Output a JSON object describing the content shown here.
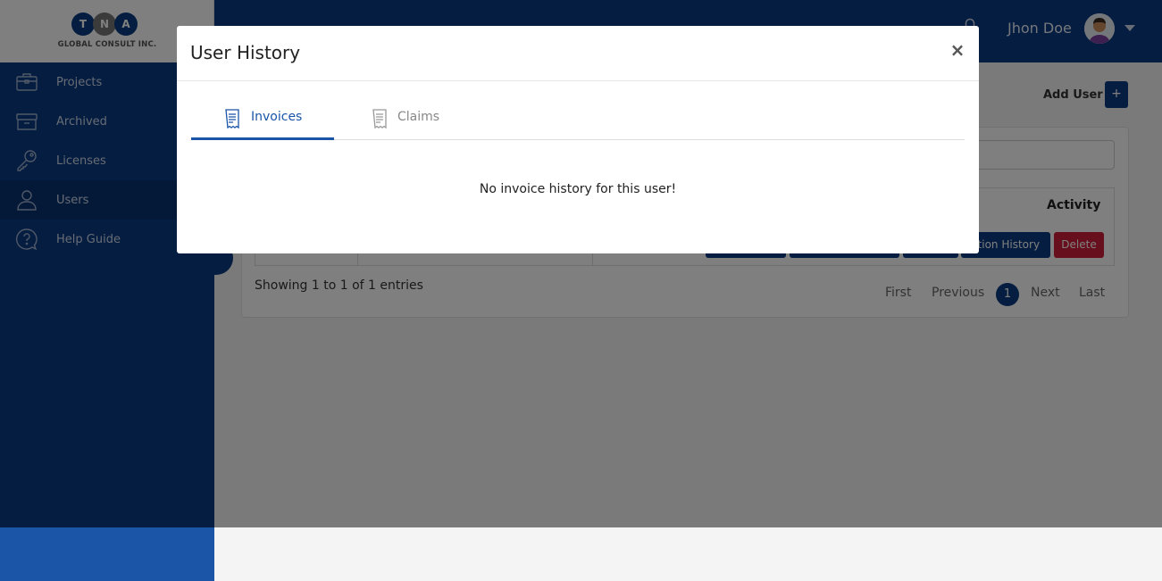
{
  "logo": {
    "letters": [
      "T",
      "N",
      "A"
    ],
    "text": "GLOBAL CONSULT INC."
  },
  "sidebar": {
    "items": [
      {
        "label": "Projects",
        "icon": "briefcase-icon"
      },
      {
        "label": "Archived",
        "icon": "archive-icon"
      },
      {
        "label": "Licenses",
        "icon": "key-icon"
      },
      {
        "label": "Users",
        "icon": "user-icon",
        "active": true
      },
      {
        "label": "Help Guide",
        "icon": "help-icon"
      }
    ]
  },
  "header": {
    "user_name": "Jhon Doe"
  },
  "main": {
    "add_user_label": "Add User",
    "add_user_button": "+",
    "table": {
      "visible_header": "Activity",
      "row_buttons": [
        "ction History",
        "Delete"
      ]
    },
    "showing_text": "Showing 1 to 1 of 1 entries",
    "pagination": {
      "first": "First",
      "previous": "Previous",
      "current": "1",
      "next": "Next",
      "last": "Last"
    }
  },
  "modal": {
    "title": "User History",
    "close": "×",
    "tabs": [
      {
        "label": "Invoices",
        "active": true
      },
      {
        "label": "Claims",
        "active": false
      }
    ],
    "empty_message": "No invoice history for this user!"
  },
  "colors": {
    "primary": "#0a3a80",
    "accent": "#1a55a8",
    "danger": "#d11f3a"
  }
}
